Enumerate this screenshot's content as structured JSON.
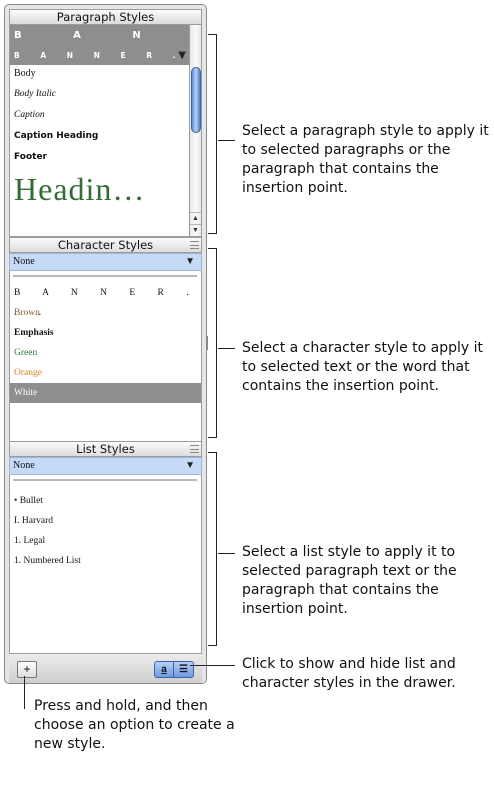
{
  "paragraph_styles": {
    "header": "Paragraph Styles",
    "items": [
      {
        "label": "B A N . . ."
      },
      {
        "label": "B A N N E R . . ."
      },
      {
        "label": "Body"
      },
      {
        "label": "Body Italic"
      },
      {
        "label": "Caption"
      },
      {
        "label": "Caption Heading"
      },
      {
        "label": "Footer"
      },
      {
        "label": "Headin…"
      }
    ],
    "scroll_up": "▲",
    "scroll_down": "▼",
    "menu_arrow": "▼"
  },
  "character_styles": {
    "header": "Character Styles",
    "selected": "None",
    "menu_arrow": "▼",
    "items": [
      {
        "label": "B A N N E R . . .",
        "color": "#111111"
      },
      {
        "label": "Brown",
        "color": "#8a5a2b"
      },
      {
        "label": "Emphasis",
        "color": "#111111"
      },
      {
        "label": "Green",
        "color": "#2f7a2f"
      },
      {
        "label": "Orange",
        "color": "#e08020"
      },
      {
        "label": "White",
        "color": "#ffffff"
      }
    ]
  },
  "list_styles": {
    "header": "List Styles",
    "selected": "None",
    "menu_arrow": "▼",
    "items": [
      {
        "label": "• Bullet"
      },
      {
        "label": "I. Harvard"
      },
      {
        "label": "1. Legal"
      },
      {
        "label": "1. Numbered List"
      }
    ]
  },
  "bottom_bar": {
    "add_label": "+",
    "char_toggle": "a",
    "list_toggle": "☰"
  },
  "callouts": {
    "paragraph": "Select a paragraph style to apply it to selected paragraphs or the paragraph that contains the insertion point.",
    "character": "Select a character style to apply it to selected text or the word that contains the insertion point.",
    "list": "Select a list style to apply it to selected paragraph text or the paragraph that contains the insertion point.",
    "toggle": "Click to show and hide list and character styles in the drawer.",
    "add": "Press and hold, and then choose an option to create a new style."
  },
  "colors": {
    "selection_gray": "#8e8e8e",
    "dropdown_blue": "#c5daf6",
    "heading_green": "#356b35"
  }
}
